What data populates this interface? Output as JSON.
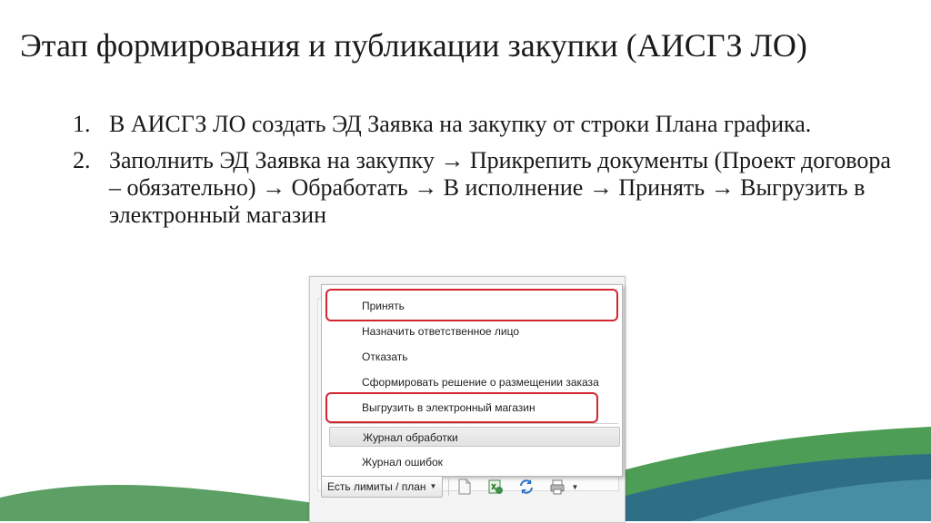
{
  "slide": {
    "title": "Этап формирования и публикации закупки (АИСГЗ ЛО)",
    "steps": [
      {
        "num": "1.",
        "text": "В АИСГЗ ЛО создать ЭД Заявка на закупку от строки Плана графика."
      },
      {
        "num": "2.",
        "text": "Заполнить ЭД Заявка на закупку → Прикрепить документы (Проект договора – обязательно) → Обработать → В исполнение → Принять → Выгрузить в электронный магазин"
      }
    ]
  },
  "menu": {
    "items": [
      {
        "label": "Принять",
        "highlighted": true
      },
      {
        "label": "Назначить ответственное лицо",
        "highlighted": false
      },
      {
        "label": "Отказать",
        "highlighted": false
      },
      {
        "label": "Сформировать решение о размещении заказа",
        "highlighted": false
      },
      {
        "label": "Выгрузить в электронный магазин",
        "highlighted": true
      }
    ],
    "journal_items": [
      {
        "label": "Журнал обработки"
      },
      {
        "label": "Журнал ошибок"
      }
    ]
  },
  "toolbar": {
    "limits_label": "Есть лимиты / план",
    "icons": [
      "document-icon",
      "excel-refresh-icon",
      "refresh-icon",
      "print-icon"
    ]
  },
  "colors": {
    "highlight": "#d2262e",
    "wave_green": "#3f8f4a",
    "wave_teal": "#2f6f86"
  }
}
